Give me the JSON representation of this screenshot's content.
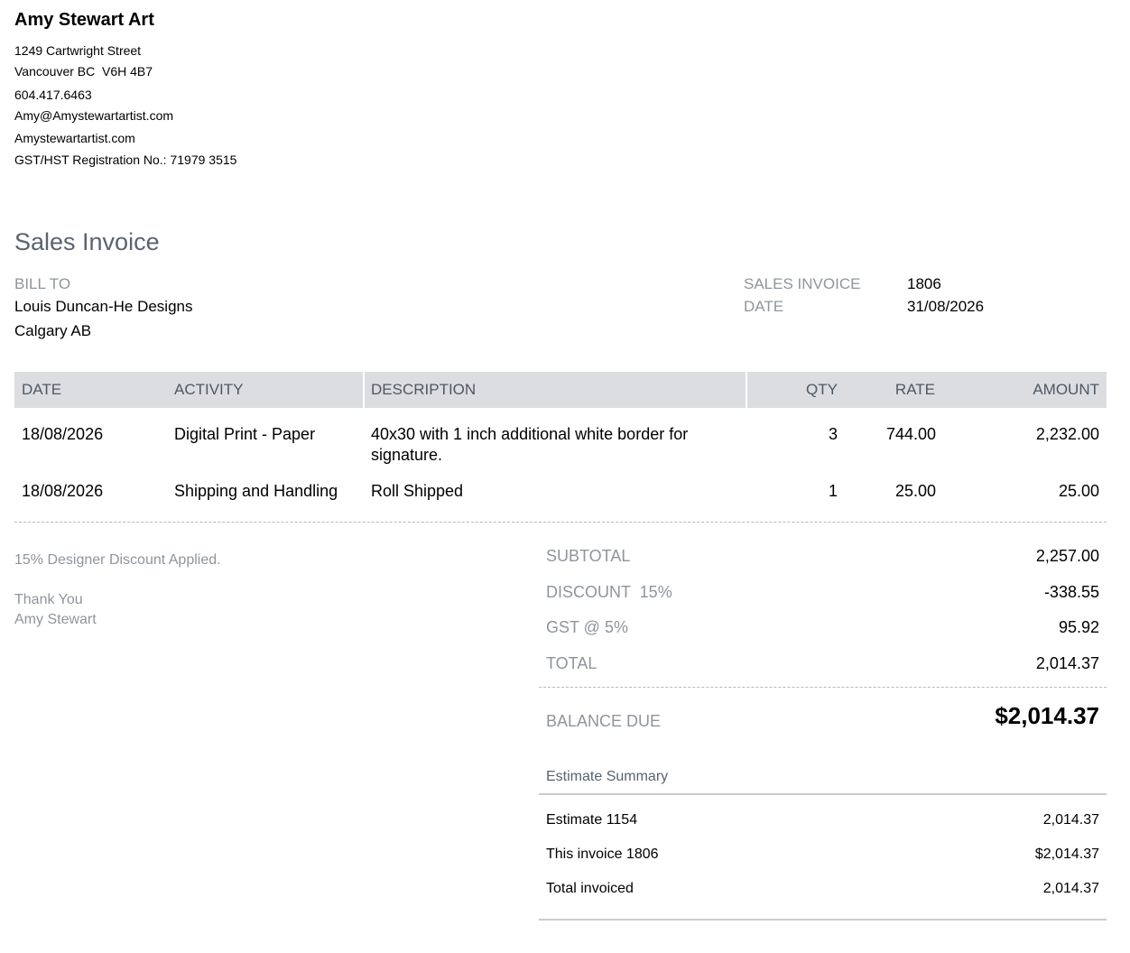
{
  "company": {
    "name": "Amy Stewart Art",
    "address_line1": "1249 Cartwright Street",
    "address_line2": "Vancouver BC  V6H 4B7",
    "phone": "604.417.6463",
    "email": "Amy@Amystewartartist.com",
    "website": "Amystewartartist.com",
    "gst": "GST/HST Registration No.: 71979 3515"
  },
  "document_title": "Sales Invoice",
  "bill_to": {
    "label": "BILL TO",
    "name": "Louis Duncan-He Designs",
    "city": "Calgary AB"
  },
  "invoice_meta": {
    "number_label": "SALES INVOICE",
    "number": "1806",
    "date_label": "DATE",
    "date": "31/08/2026"
  },
  "table": {
    "headers": [
      "DATE",
      "ACTIVITY",
      "DESCRIPTION",
      "QTY",
      "RATE",
      "AMOUNT"
    ],
    "rows": [
      {
        "date": "18/08/2026",
        "activity": "Digital Print - Paper",
        "description": "40x30 with 1 inch additional white border for signature.",
        "qty": "3",
        "rate": "744.00",
        "amount": "2,232.00"
      },
      {
        "date": "18/08/2026",
        "activity": "Shipping and Handling",
        "description": "Roll Shipped",
        "qty": "1",
        "rate": "25.00",
        "amount": "25.00"
      }
    ]
  },
  "notes": {
    "discount_note": "15% Designer Discount Applied.",
    "thanks": "Thank You",
    "signature": "Amy Stewart"
  },
  "totals": {
    "subtotal_label": "SUBTOTAL",
    "subtotal": "2,257.00",
    "discount_label": "DISCOUNT  15%",
    "discount": "-338.55",
    "gst_label": "GST @ 5%",
    "gst": "95.92",
    "total_label": "TOTAL",
    "total": "2,014.37",
    "balance_label": "BALANCE DUE",
    "balance": "$2,014.37"
  },
  "estimate_summary": {
    "title": "Estimate Summary",
    "rows": [
      {
        "label": "Estimate 1154",
        "value": "2,014.37"
      },
      {
        "label": "This invoice 1806",
        "value": "$2,014.37"
      },
      {
        "label": "Total invoiced",
        "value": "2,014.37"
      }
    ]
  }
}
